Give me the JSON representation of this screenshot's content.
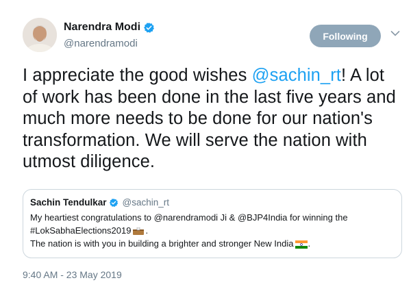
{
  "author": {
    "name": "Narendra Modi",
    "handle": "@narendramodi",
    "verified": true
  },
  "follow_button": {
    "label": "Following"
  },
  "tweet": {
    "segments": [
      "I appreciate the good wishes ",
      "@sachin_rt",
      "! A lot of work has been done in the last five years and much more needs to be done for our nation's transformation. We will serve the nation with utmost diligence."
    ]
  },
  "quoted_tweet": {
    "name": "Sachin Tendulkar",
    "handle": "@sachin_rt",
    "line1": "My heartiest congratulations to @narendramodi Ji & @BJP4India for winning the",
    "line2": "#LokSabhaElections2019",
    "line2_end": ".",
    "line3": "The nation is with you in building a brighter and stronger New India",
    "line3_end": "."
  },
  "timestamp": "9:40 AM - 23 May 2019",
  "colors": {
    "link": "#1da1f2",
    "following_button": "#8fa6b8",
    "verified_badge": "#1da1f2",
    "secondary_text": "#657786"
  },
  "icons": {
    "verified": "verified-badge-icon",
    "caret": "chevron-down-icon",
    "flag": "india-flag-icon",
    "ballot": "ballot-box-icon"
  }
}
